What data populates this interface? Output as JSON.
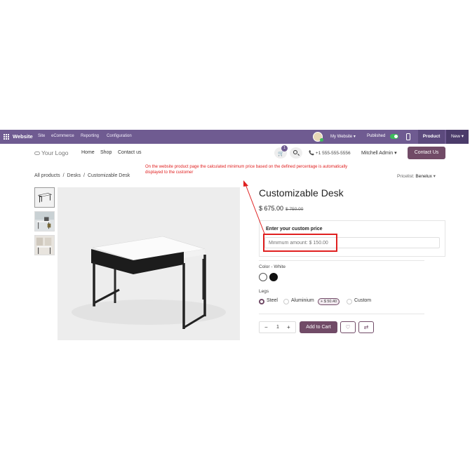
{
  "topbar": {
    "app": "Website",
    "menus": [
      "Site",
      "eCommerce",
      "Reporting",
      "Configuration"
    ],
    "my_website": "My Website",
    "published": "Published",
    "product": "Product",
    "new": "New"
  },
  "header": {
    "logo": "Your Logo",
    "nav": [
      "Home",
      "Shop",
      "Contact us"
    ],
    "cart_count": "1",
    "phone": "+1 555-555-5556",
    "user": "Mitchell Admin",
    "contact_button": "Contact Us"
  },
  "breadcrumb": [
    "All products",
    "Desks",
    "Customizable Desk"
  ],
  "annotation": "On the website product page the calculated minimum price based on the defined percentage is automatically displayed to the customer",
  "pricelist": {
    "label": "Pricelist:",
    "value": "Benelux"
  },
  "product": {
    "name": "Customizable Desk",
    "price": "$ 675.00",
    "old_price": "$ 750.00",
    "custom_price_label": "Enter your custom price",
    "custom_price_placeholder": "Minimum amount: $ 150.00",
    "color_label": "Color",
    "color_value": "White",
    "colors": [
      "#ffffff",
      "#111111"
    ],
    "legs_label": "Legs",
    "legs": [
      "Steel",
      "Aluminium",
      "Custom"
    ],
    "legs_extra": "+ $ 50.40",
    "quantity": "1",
    "add_to_cart": "Add to Cart"
  },
  "accent": "#714b67"
}
